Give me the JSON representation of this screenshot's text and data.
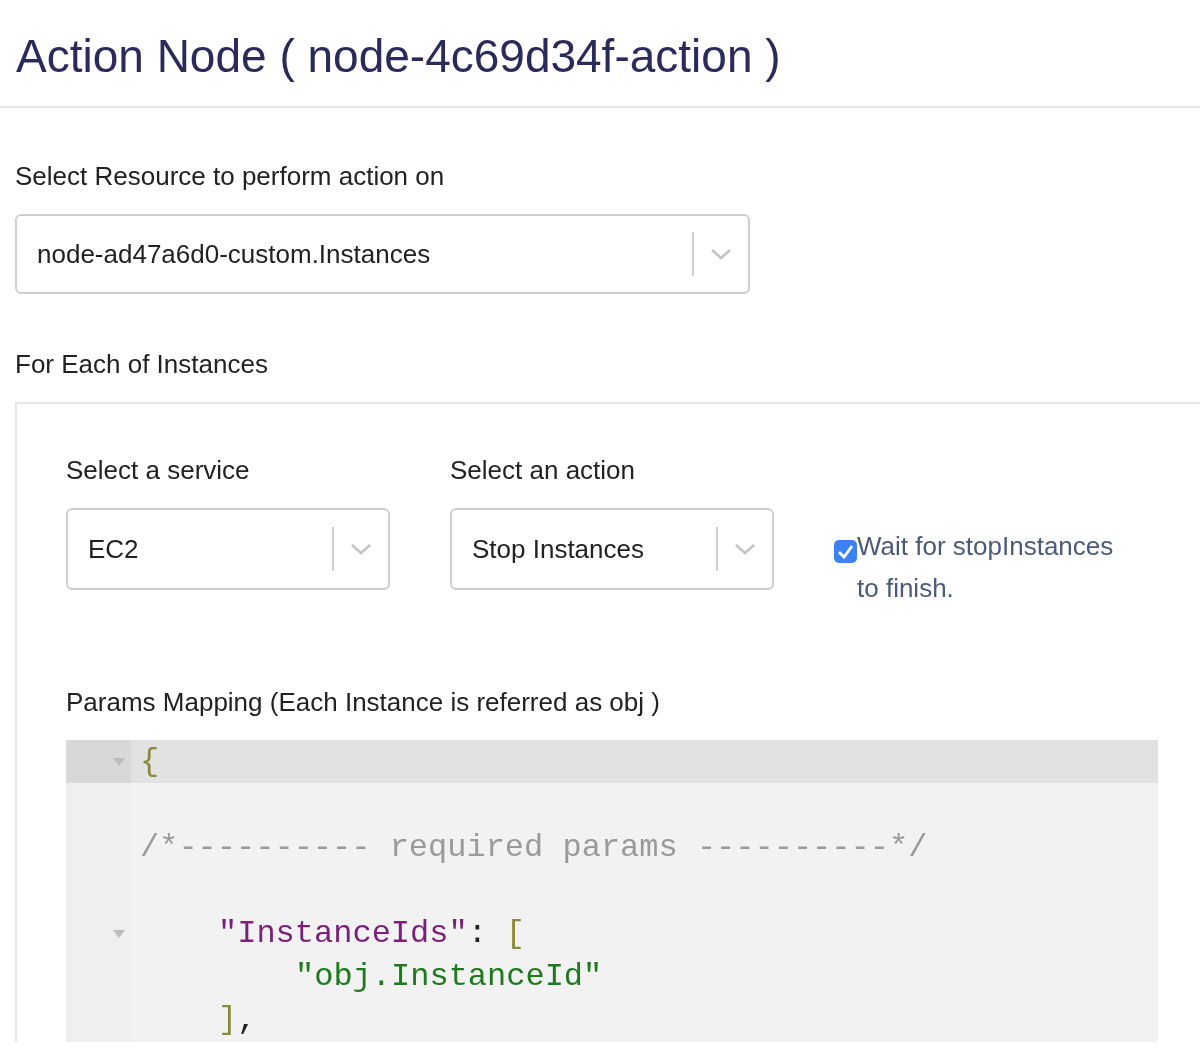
{
  "title": "Action Node ( node-4c69d34f-action )",
  "resource": {
    "label": "Select Resource to perform action on",
    "value": "node-ad47a6d0-custom.Instances"
  },
  "for_each": {
    "label": "For Each of Instances",
    "service": {
      "label": "Select a service",
      "value": "EC2"
    },
    "action": {
      "label": "Select an action",
      "value": "Stop Instances"
    },
    "wait": {
      "label": "Wait for stopInstances to finish.",
      "checked": true
    },
    "params": {
      "label": "Params Mapping (Each Instance is referred as obj )",
      "lines": [
        {
          "kind": "outer",
          "active": true,
          "fold": true,
          "tokens": [
            {
              "kind": "bracket",
              "text": "{"
            }
          ]
        },
        {
          "kind": "blank",
          "active": false,
          "fold": false
        },
        {
          "kind": "outer",
          "active": false,
          "fold": false,
          "tokens": [
            {
              "kind": "comment",
              "text": "/*---------- required params ----------*/"
            }
          ]
        },
        {
          "kind": "blank",
          "active": false,
          "fold": false
        },
        {
          "kind": "member",
          "active": false,
          "fold": true,
          "tokens": [
            {
              "kind": "key",
              "text": "\"InstanceIds\""
            },
            {
              "kind": "punct",
              "text": ":"
            },
            {
              "kind": "bracket",
              "text": "["
            }
          ],
          "children": [
            {
              "kind": "member",
              "active": false,
              "fold": false,
              "tokens": [
                {
                  "kind": "string",
                  "text": "\"obj.InstanceId\""
                }
              ]
            }
          ]
        },
        {
          "kind": "member",
          "active": false,
          "fold": false,
          "tokens": [
            {
              "kind": "bracket",
              "text": "]"
            },
            {
              "kind": "punct",
              "text": ","
            }
          ]
        }
      ]
    }
  }
}
